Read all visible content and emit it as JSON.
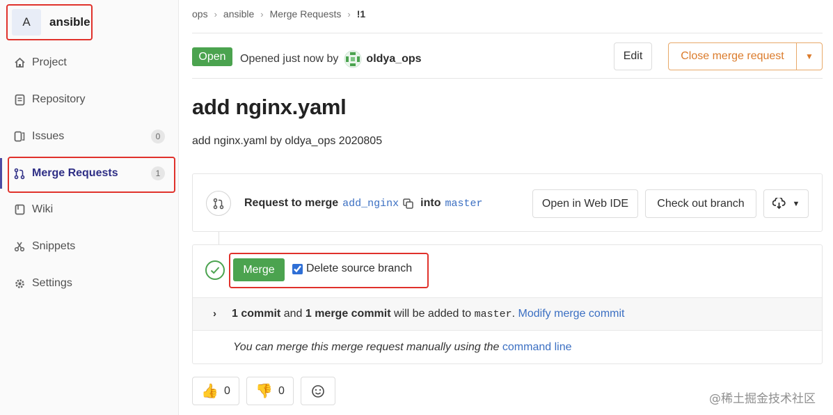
{
  "sidebar": {
    "project_avatar": "A",
    "project_name": "ansible",
    "items": [
      {
        "label": "Project",
        "icon": "home-icon"
      },
      {
        "label": "Repository",
        "icon": "repository-icon"
      },
      {
        "label": "Issues",
        "icon": "issues-icon",
        "badge": "0"
      },
      {
        "label": "Merge Requests",
        "icon": "merge-request-icon",
        "badge": "1",
        "active": true
      },
      {
        "label": "Wiki",
        "icon": "wiki-icon"
      },
      {
        "label": "Snippets",
        "icon": "snippets-icon"
      },
      {
        "label": "Settings",
        "icon": "settings-icon"
      }
    ]
  },
  "breadcrumb": [
    "ops",
    "ansible",
    "Merge Requests",
    "!1"
  ],
  "header": {
    "status": "Open",
    "opened_text": "Opened just now by",
    "author": "oldya_ops",
    "edit_label": "Edit",
    "close_label": "Close merge request"
  },
  "mr": {
    "title": "add nginx.yaml",
    "description": "add nginx.yaml by oldya_ops 2020805"
  },
  "branch": {
    "prefix": "Request to merge",
    "source": "add_nginx",
    "into": "into",
    "target": "master",
    "open_ide": "Open in Web IDE",
    "checkout": "Check out branch"
  },
  "merge": {
    "button": "Merge",
    "delete_source": "Delete source branch",
    "delete_checked": true,
    "commit_count": "1 commit",
    "and": " and ",
    "merge_commit": "1 merge commit",
    "added_to": " will be added to ",
    "target": "master",
    "dot": ". ",
    "modify": "Modify merge commit",
    "manual_text": "You can merge this merge request manually using the ",
    "command_line": "command line"
  },
  "awards": {
    "thumbs_up": "0",
    "thumbs_down": "0"
  },
  "watermark": "@稀土掘金技术社区",
  "colors": {
    "success": "#4ba34f",
    "warning": "#db7b2b",
    "link": "#3b6fc2",
    "highlight_box": "#e0312b"
  }
}
